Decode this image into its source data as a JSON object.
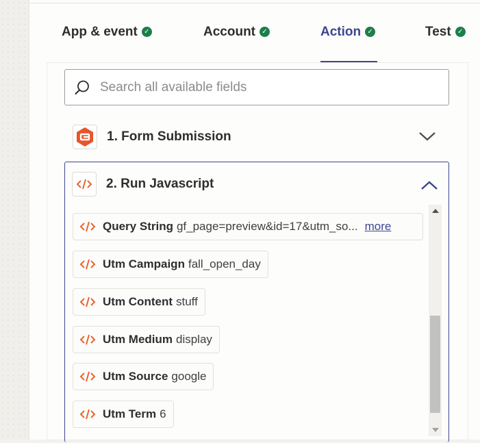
{
  "tabs": [
    {
      "label": "App & event",
      "active": false
    },
    {
      "label": "Account",
      "active": false
    },
    {
      "label": "Action",
      "active": true
    },
    {
      "label": "Test",
      "active": false
    }
  ],
  "search": {
    "placeholder": "Search all available fields"
  },
  "steps": [
    {
      "title": "1. Form Submission",
      "icon": "gravity-forms-icon",
      "expanded": false
    },
    {
      "title": "2. Run Javascript",
      "icon": "code-icon",
      "expanded": true
    }
  ],
  "fields": [
    {
      "name": "Query String",
      "value": "gf_page=preview&id=17&utm_so...",
      "more": "more"
    },
    {
      "name": "Utm Campaign",
      "value": "fall_open_day"
    },
    {
      "name": "Utm Content",
      "value": "stuff"
    },
    {
      "name": "Utm Medium",
      "value": "display"
    },
    {
      "name": "Utm Source",
      "value": "google"
    },
    {
      "name": "Utm Term",
      "value": "6"
    }
  ],
  "colors": {
    "accent": "#3d4592",
    "success": "#1b7f4a",
    "code_orange": "#e8642c",
    "gravity_orange": "#e8542c"
  }
}
